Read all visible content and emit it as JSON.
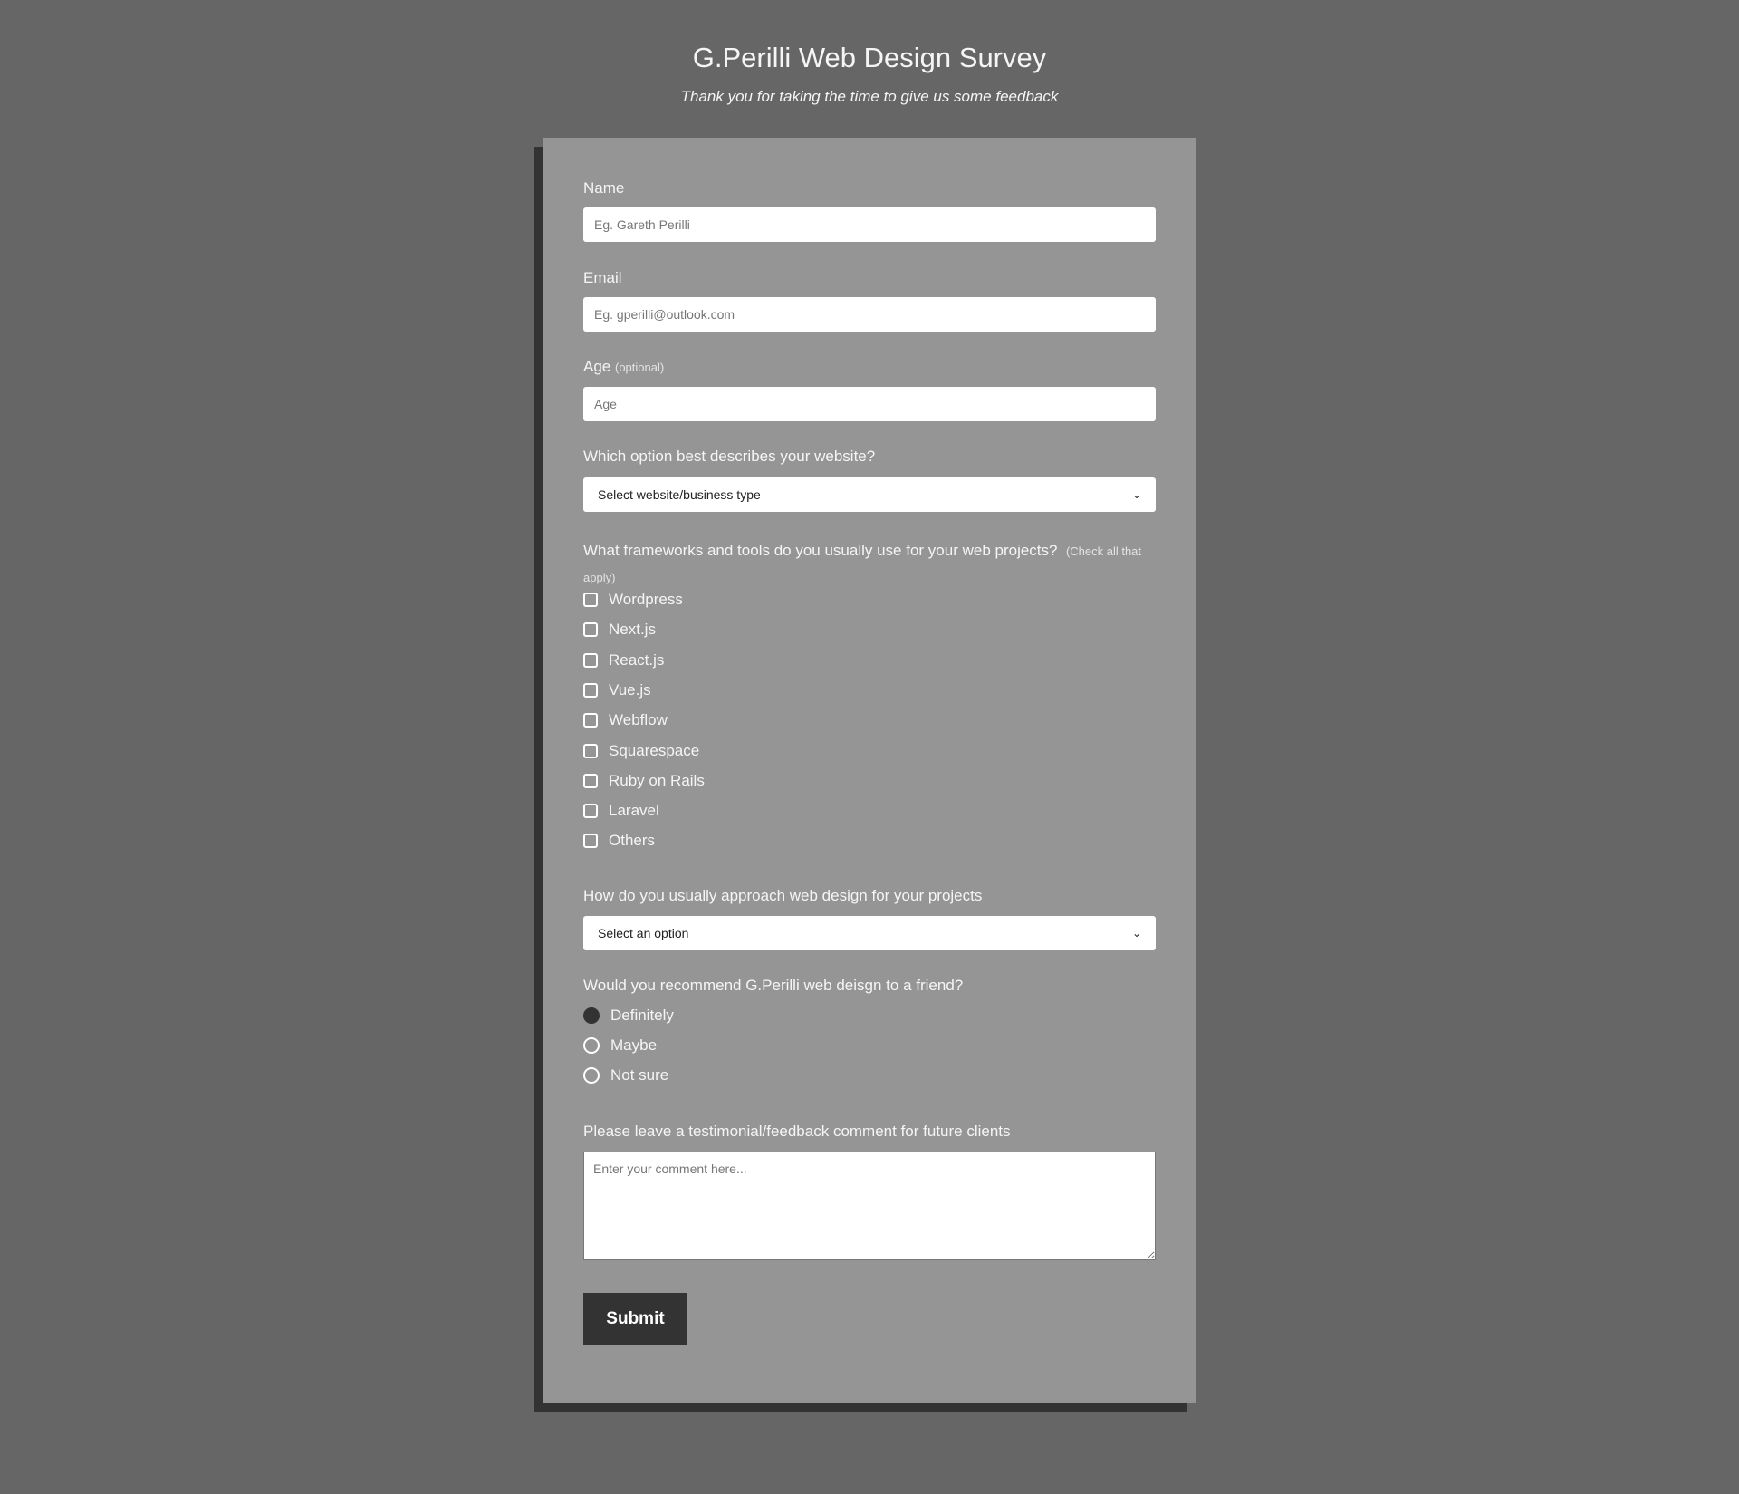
{
  "header": {
    "title": "G.Perilli Web Design Survey",
    "subtitle": "Thank you for taking the time to give us some feedback"
  },
  "form": {
    "name": {
      "label": "Name",
      "placeholder": "Eg. Gareth Perilli"
    },
    "email": {
      "label": "Email",
      "placeholder": "Eg. gperilli@outlook.com"
    },
    "age": {
      "label": "Age",
      "hint": "(optional)",
      "placeholder": "Age"
    },
    "website_type": {
      "label": "Which option best describes your website?",
      "selected": "Select website/business type"
    },
    "frameworks": {
      "label": "What frameworks and tools do you usually use for your web projects?",
      "hint": "(Check all that apply)",
      "options": [
        "Wordpress",
        "Next.js",
        "React.js",
        "Vue.js",
        "Webflow",
        "Squarespace",
        "Ruby on Rails",
        "Laravel",
        "Others"
      ],
      "checked": []
    },
    "approach": {
      "label": "How do you usually approach web design for your projects",
      "selected": "Select an option"
    },
    "recommend": {
      "label": "Would you recommend G.Perilli web deisgn to a friend?",
      "options": [
        "Definitely",
        "Maybe",
        "Not sure"
      ],
      "selected": "Definitely"
    },
    "comment": {
      "label": "Please leave a testimonial/feedback comment for future clients",
      "placeholder": "Enter your comment here..."
    },
    "submit_label": "Submit"
  },
  "colors": {
    "background": "#666666",
    "card": "#959595",
    "shadow": "#333333",
    "button": "#333333"
  },
  "icons": {
    "select_arrow": "chevron-down-icon"
  }
}
